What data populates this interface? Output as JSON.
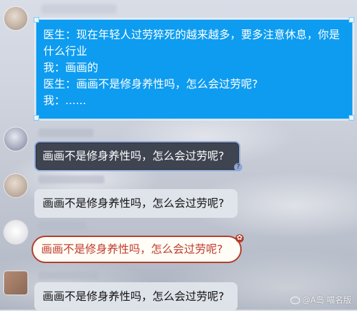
{
  "messages": {
    "first": {
      "lines": [
        "医生：现在年轻人过劳猝死的越来越多，要多注意休息，你是",
        "什么行业",
        "我：画画的",
        "医生：画画不是修身养性吗，怎么会过劳呢?",
        "我：......"
      ]
    },
    "second": {
      "text": "画画不是修身养性吗，怎么会过劳呢?"
    },
    "third": {
      "text": "画画不是修身养性吗，怎么会过劳呢?"
    },
    "fourth": {
      "text": "画画不是修身养性吗，怎么会过劳呢?"
    },
    "fifth": {
      "text": "画画不是修身养性吗，怎么会过劳呢?"
    }
  },
  "watermark": {
    "text": "@A岛 喵名版"
  },
  "colors": {
    "blue_bubble": "#0d9cf0",
    "dark_bubble": "#3f4451",
    "red_outline": "#b33a2a",
    "red_text": "#c0392b"
  }
}
